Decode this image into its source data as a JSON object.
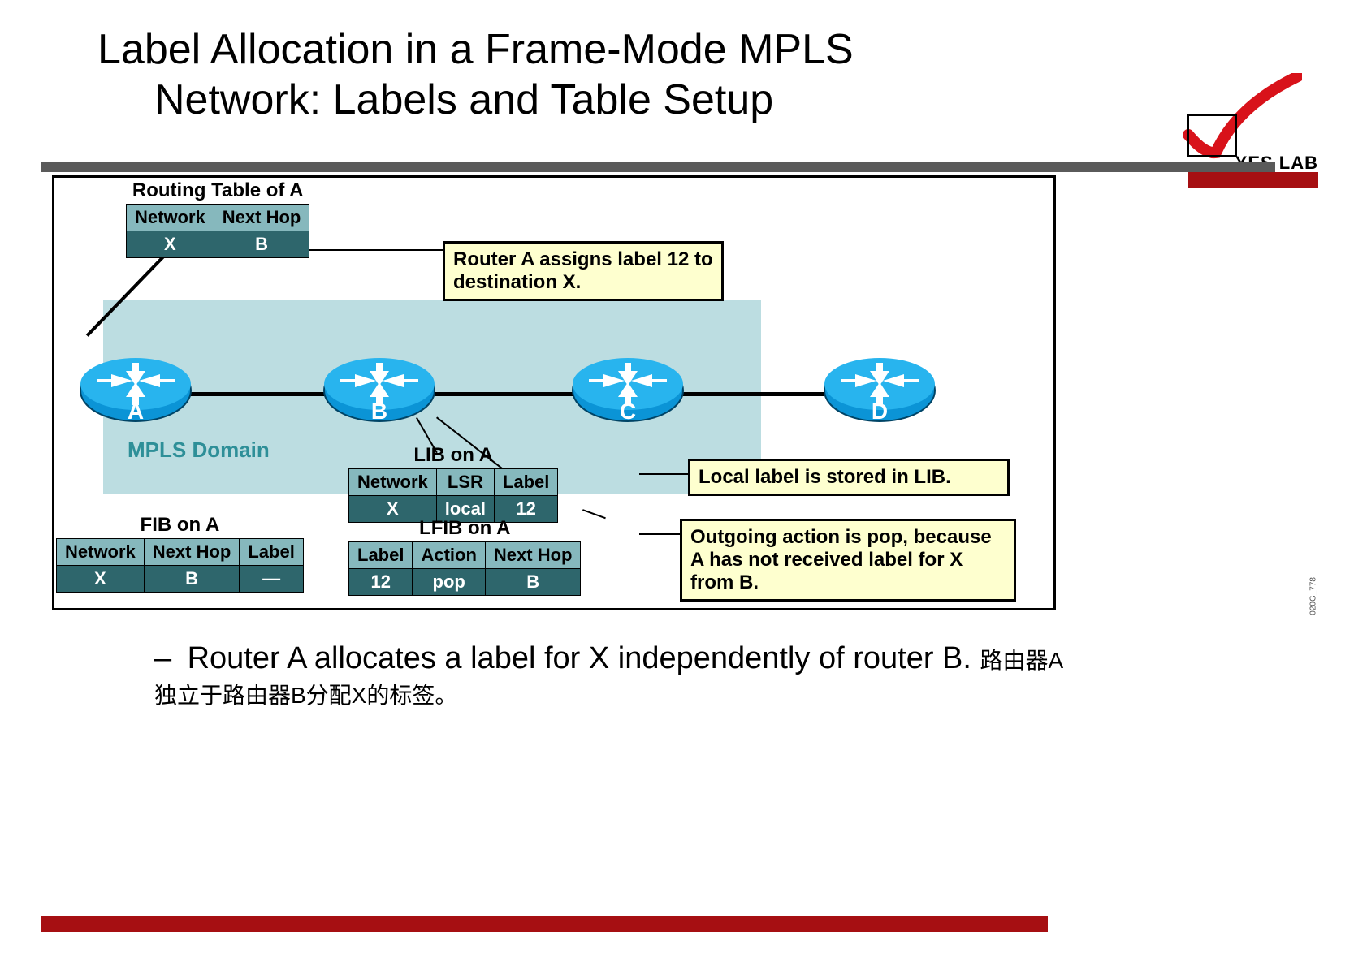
{
  "title_line1": "Label Allocation in a Frame-Mode MPLS",
  "title_line2": "Network: Labels and Table Setup",
  "logo_text": "YES LAB",
  "mpls_domain_label": "MPLS Domain",
  "routers": {
    "A": "A",
    "B": "B",
    "C": "C",
    "D": "D"
  },
  "routing_table": {
    "title": "Routing Table of A",
    "headers": [
      "Network",
      "Next Hop"
    ],
    "row": [
      "X",
      "B"
    ]
  },
  "lib": {
    "title": "LIB on A",
    "headers": [
      "Network",
      "LSR",
      "Label"
    ],
    "row": [
      "X",
      "local",
      "12"
    ]
  },
  "fib": {
    "title": "FIB on A",
    "headers": [
      "Network",
      "Next Hop",
      "Label"
    ],
    "row": [
      "X",
      "B",
      "—"
    ]
  },
  "lfib": {
    "title": "LFIB on A",
    "headers": [
      "Label",
      "Action",
      "Next Hop"
    ],
    "row": [
      "12",
      "pop",
      "B"
    ]
  },
  "note_assign": "Router A assigns label 12 to destination X.",
  "note_lib": "Local label is stored in LIB.",
  "note_lfib": "Outgoing action is pop, because A has not received label for X from B.",
  "bullet_en": "Router A allocates a label for X independently of router B.",
  "bullet_cn": "路由器A独立于路由器B分配X的标签。",
  "image_code": "020G_778"
}
